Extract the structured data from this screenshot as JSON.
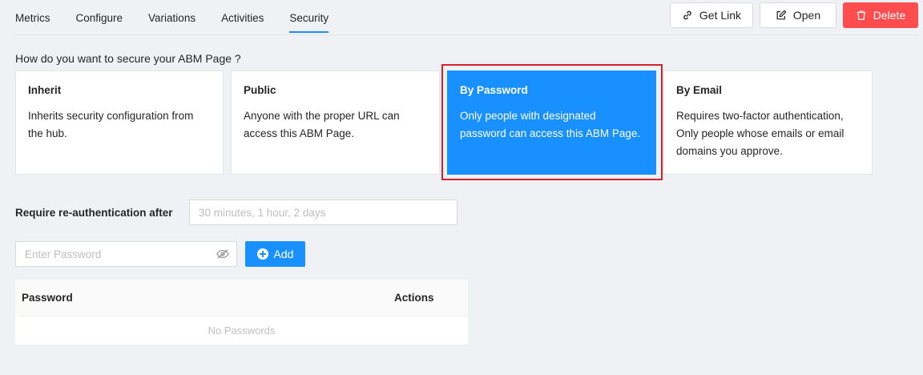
{
  "tabs": [
    {
      "label": "Metrics",
      "active": false
    },
    {
      "label": "Configure",
      "active": false
    },
    {
      "label": "Variations",
      "active": false
    },
    {
      "label": "Activities",
      "active": false
    },
    {
      "label": "Security",
      "active": true
    }
  ],
  "actions": {
    "get_link": {
      "label": "Get Link",
      "icon": "link-icon"
    },
    "open": {
      "label": "Open",
      "icon": "edit-icon"
    },
    "delete": {
      "label": "Delete",
      "icon": "trash-icon"
    }
  },
  "security": {
    "question": "How do you want to secure your ABM Page ?",
    "selected": "By Password",
    "options": [
      {
        "title": "Inherit",
        "description": "Inherits security configuration from the hub."
      },
      {
        "title": "Public",
        "description": "Anyone with the proper URL can access this ABM Page."
      },
      {
        "title": "By Password",
        "description": "Only people with designated password can access this ABM Page."
      },
      {
        "title": "By Email",
        "description": "Requires two-factor authentication, Only people whose emails or email domains you approve."
      }
    ]
  },
  "reauth": {
    "label": "Require re-authentication after",
    "placeholder": "30 minutes, 1 hour, 2 days",
    "value": ""
  },
  "password_input": {
    "placeholder": "Enter Password",
    "value": "",
    "toggle_icon": "eye-hidden-icon"
  },
  "add_button": {
    "label": "Add",
    "icon": "plus-circle-icon"
  },
  "table": {
    "columns": [
      "Password",
      "Actions"
    ],
    "empty_text": "No Passwords"
  },
  "colors": {
    "primary": "#1890ff",
    "danger": "#ff4d4f",
    "highlight_border": "#d9202b"
  }
}
